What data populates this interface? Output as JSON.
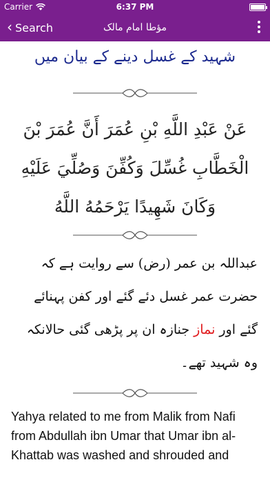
{
  "status": {
    "carrier": "Carrier",
    "time": "6:37 PM",
    "battery_level": 1.0
  },
  "nav": {
    "back_label": "Search",
    "title": "مؤطا امام مالک"
  },
  "chapter_heading": "شہید کے غسل دینے کے بیان میں",
  "hadith_arabic": "عَنْ عَبْدِ اللَّهِ بْنِ عُمَرَ أَنَّ عُمَرَ بْنَ الْخَطَّابِ غُسِّلَ وَكُفِّنَ وَصُلِّيَ عَلَيْهِ وَكَانَ شَهِيدًا يَرْحَمُهُ اللَّهُ",
  "translation_urdu": {
    "before": "عبداللہ بن عمر (رض) سے روایت ہے کہ حضرت عمر غسل دئے گئے اور کفن پہنائے گئے اور ",
    "highlight": "نماز",
    "after": " جنازہ ان پر پڑھی گئی حالانکہ وہ شہید تھے۔"
  },
  "translation_english": "Yahya related to me from Malik from Nafi from Abdullah ibn Umar that Umar ibn al-Khattab was washed and shrouded and",
  "colors": {
    "accent": "#7a1f8e",
    "heading": "#1d2b8f",
    "highlight": "#e0191c"
  }
}
